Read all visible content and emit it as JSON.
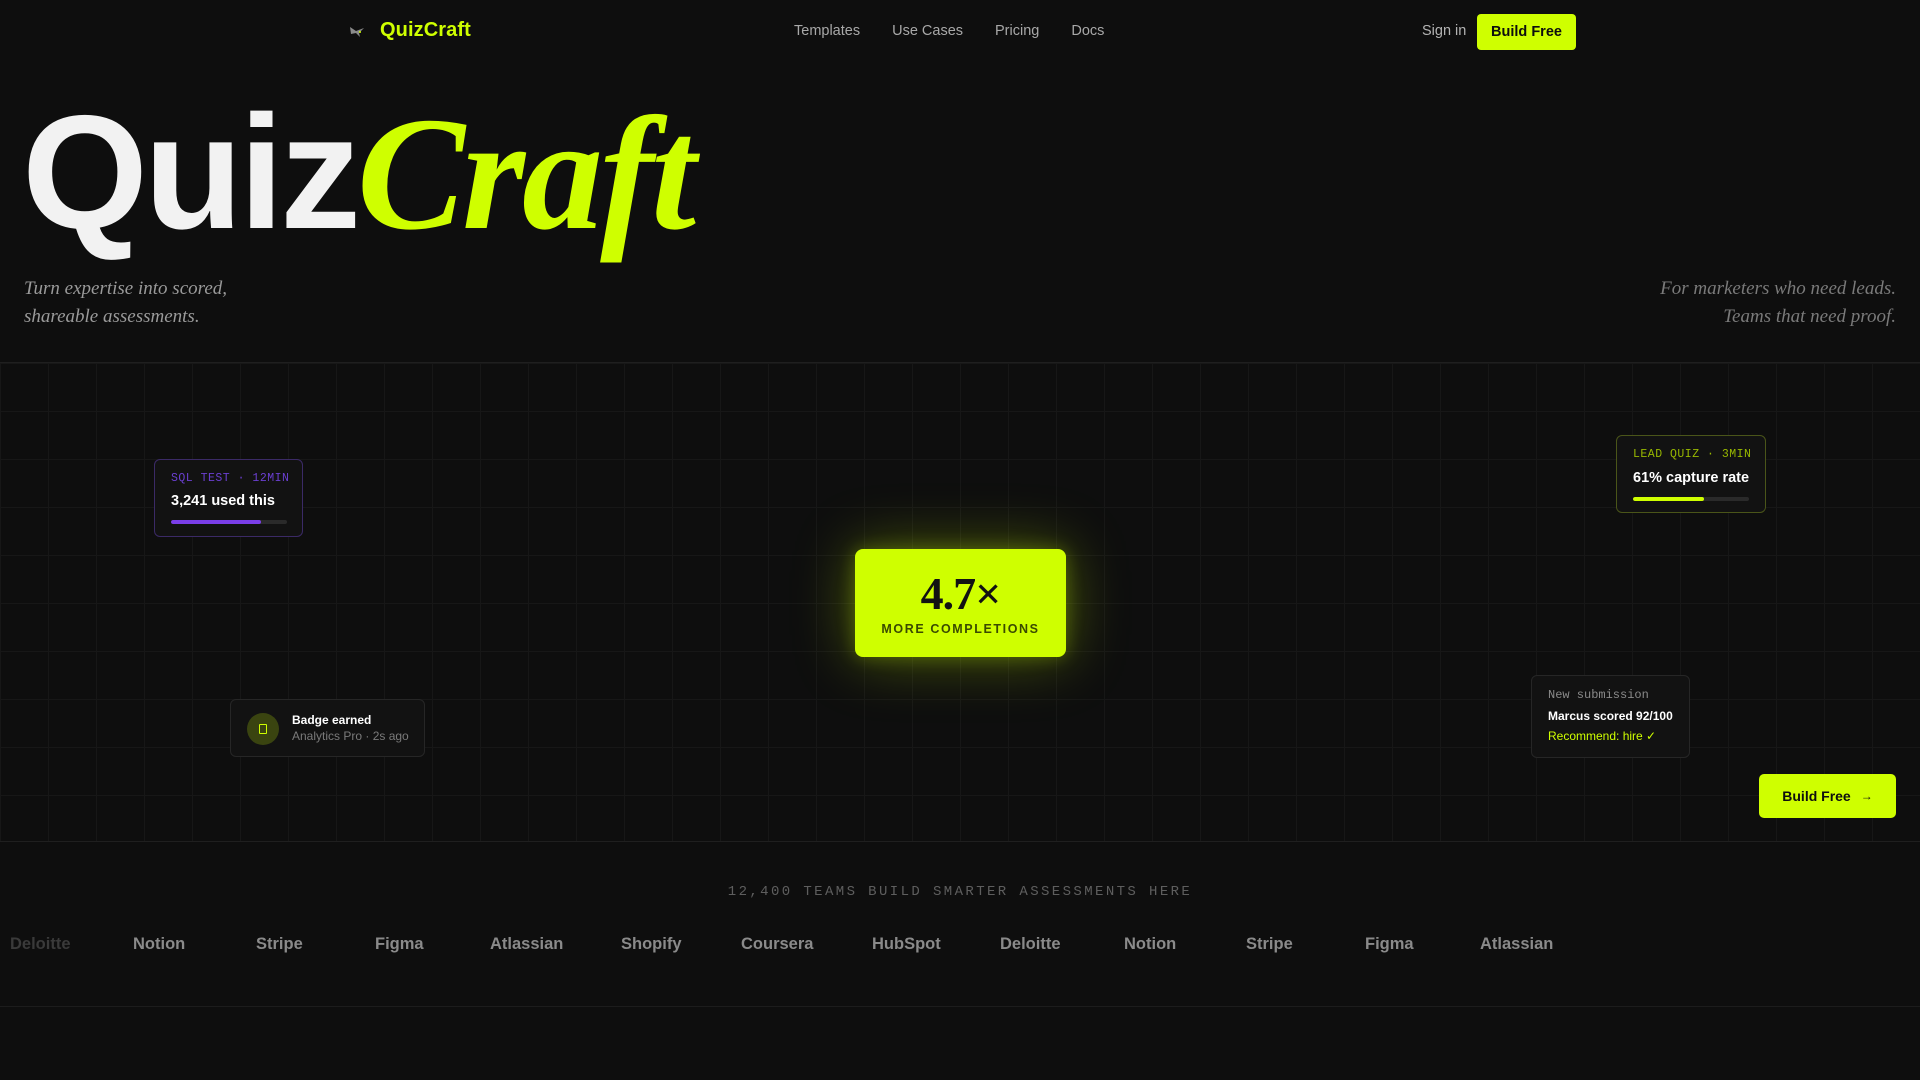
{
  "brand": {
    "name": "QuizCraft",
    "icon": "bird-icon"
  },
  "nav": {
    "links": [
      "Templates",
      "Use Cases",
      "Pricing",
      "Docs"
    ],
    "signin": "Sign in",
    "cta": "Build Free"
  },
  "hero": {
    "title_part1": "Quiz",
    "title_part2": "Craft",
    "tagline_left": "Turn expertise into scored, shareable assessments.",
    "tagline_right_line1": "For marketers who need leads.",
    "tagline_right_line2": "Teams that need proof."
  },
  "cards": {
    "sql": {
      "kicker": "SQL TEST · 12MIN",
      "main": "3,241 used this",
      "progress": 0.78,
      "color": "#7a3ee8"
    },
    "lead": {
      "kicker": "LEAD QUIZ · 3MIN",
      "main": "61% capture rate",
      "progress": 0.61,
      "color": "#cfff00"
    },
    "badge": {
      "title": "Badge earned",
      "meta": "Analytics Pro · 2s ago",
      "icon": "badge-icon"
    },
    "submission": {
      "kicker": "New submission",
      "main": "Marcus scored 92/100",
      "recommend": "Recommend: hire ✓"
    }
  },
  "stat": {
    "value": "4.7×",
    "label": "MORE COMPLETIONS"
  },
  "stage_cta": {
    "label": "Build Free",
    "arrow": "→"
  },
  "teams": {
    "label": "12,400 TEAMS BUILD SMARTER ASSESSMENTS HERE",
    "logos": [
      "Deloitte",
      "Notion",
      "Stripe",
      "Figma",
      "Atlassian",
      "Shopify",
      "Coursera",
      "HubSpot",
      "Deloitte",
      "Notion",
      "Stripe",
      "Figma",
      "Atlassian"
    ]
  },
  "colors": {
    "accent": "#cfff00",
    "background": "#0e0e0e",
    "purple": "#7a3ee8"
  }
}
